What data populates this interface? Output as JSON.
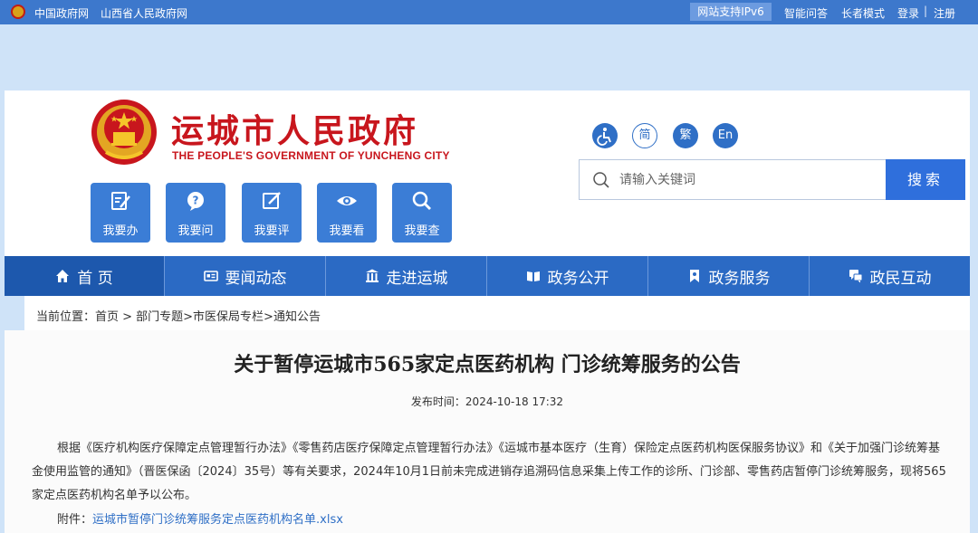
{
  "topbar": {
    "link_gov_cn": "中国政府网",
    "link_shanxi": "山西省人民政府网",
    "ipv6": "网站支持IPv6",
    "smart_qa": "智能问答",
    "elder_mode": "长者模式",
    "login": "登录",
    "register": "注册",
    "separator": "|"
  },
  "header": {
    "title": "运城市人民政府",
    "subtitle": "THE PEOPLE'S GOVERNMENT OF YUNCHENG  CITY",
    "quick_links": [
      "我要办",
      "我要问",
      "我要评",
      "我要看",
      "我要查"
    ],
    "lang_buttons": {
      "simplified": "简",
      "traditional": "繁",
      "english": "En"
    },
    "search": {
      "placeholder": "请输入关键词",
      "button": "搜索"
    }
  },
  "nav": {
    "items": [
      "首 页",
      "要闻动态",
      "走进运城",
      "政务公开",
      "政务服务",
      "政民互动"
    ]
  },
  "breadcrumb": "当前位置：首页 > 部门专题>市医保局专栏>通知公告",
  "article": {
    "title": "关于暂停运城市565家定点医药机构 门诊统筹服务的公告",
    "publish_time": "发布时间：2024-10-18 17:32",
    "body": "根据《医疗机构医疗保障定点管理暂行办法》《零售药店医疗保障定点管理暂行办法》《运城市基本医疗（生育）保险定点医药机构医保服务协议》和《关于加强门诊统筹基金使用监管的通知》（晋医保函〔2024〕35号）等有关要求，2024年10月1日前未完成进销存追溯码信息采集上传工作的诊所、门诊部、零售药店暂停门诊统筹服务，现将565家定点医药机构名单予以公布。",
    "attachment_label": "附件：",
    "attachment_link": "运城市暂停门诊统筹服务定点医药机构名单.xlsx"
  },
  "colors": {
    "brand_red": "#c8161d",
    "nav_blue": "#2b6ac4",
    "accent_blue": "#2f6fdc"
  }
}
